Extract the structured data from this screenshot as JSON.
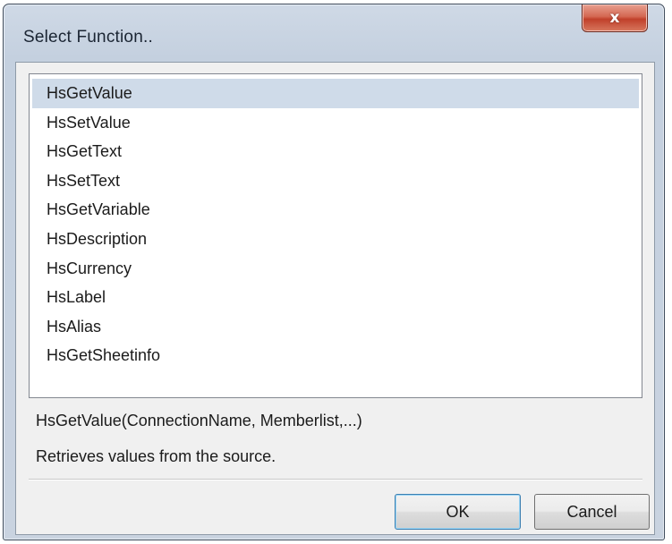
{
  "window": {
    "title": "Select Function.."
  },
  "titlebar": {
    "close_glyph": "x",
    "close_icon": "close-icon"
  },
  "function_list": {
    "selected_index": 0,
    "items": [
      "HsGetValue",
      "HsSetValue",
      "HsGetText",
      "HsSetText",
      "HsGetVariable",
      "HsDescription",
      "HsCurrency",
      "HsLabel",
      "HsAlias",
      "HsGetSheetinfo"
    ]
  },
  "details": {
    "signature": "HsGetValue(ConnectionName, Memberlist,...)",
    "description": "Retrieves values from the source."
  },
  "buttons": {
    "ok_label": "OK",
    "cancel_label": "Cancel"
  },
  "colors": {
    "selection": "#cfdbe9",
    "close_button": "#c0402a",
    "default_button_border": "#3c7fb1",
    "dialog_background": "#f0f0f0"
  }
}
